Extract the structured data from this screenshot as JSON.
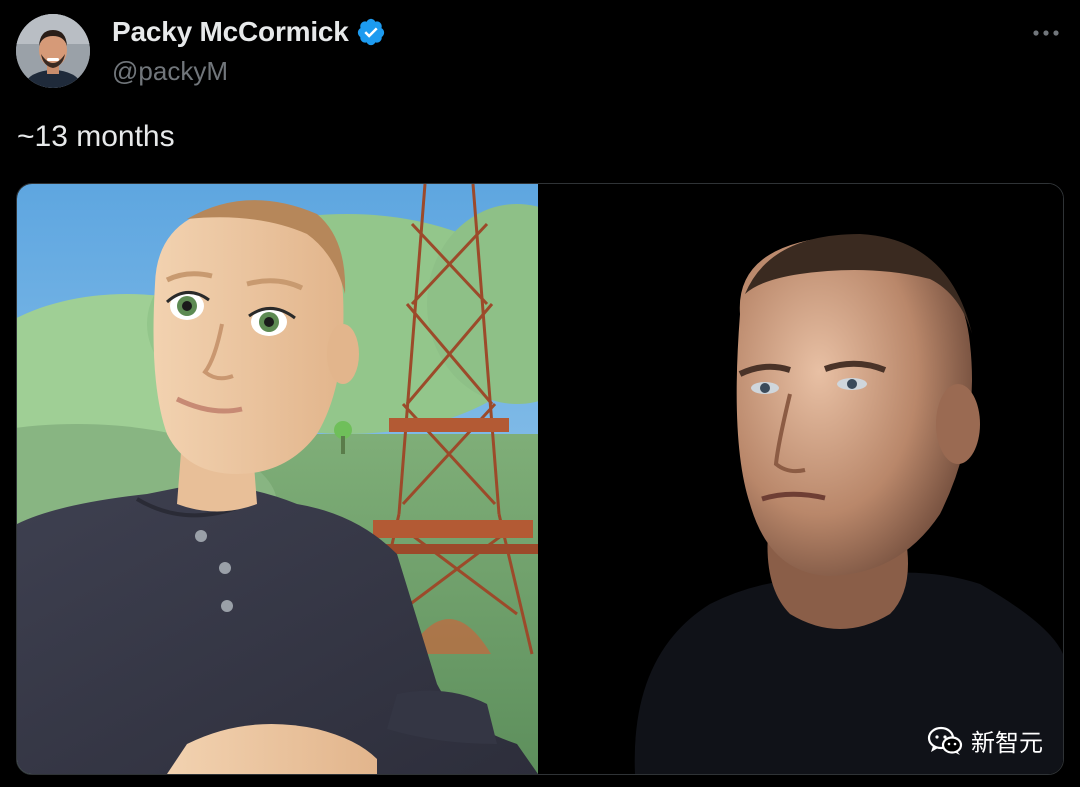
{
  "author": {
    "display_name": "Packy McCormick",
    "handle": "@packyM",
    "verified_icon": "verified-badge-icon",
    "avatar_icon": "profile-avatar"
  },
  "tweet": {
    "text": "~13 months"
  },
  "menu": {
    "more_icon": "more-options-icon"
  },
  "media": {
    "left_image": "avatar-render-eiffel-tower",
    "right_image": "person-photo-dark-background",
    "watermark_text": "新智元",
    "watermark_icon": "wechat-icon"
  },
  "colors": {
    "background": "#000000",
    "text_primary": "#e7e9ea",
    "text_secondary": "#71767b",
    "verified_blue": "#1d9bf0",
    "border": "#2f3336"
  }
}
